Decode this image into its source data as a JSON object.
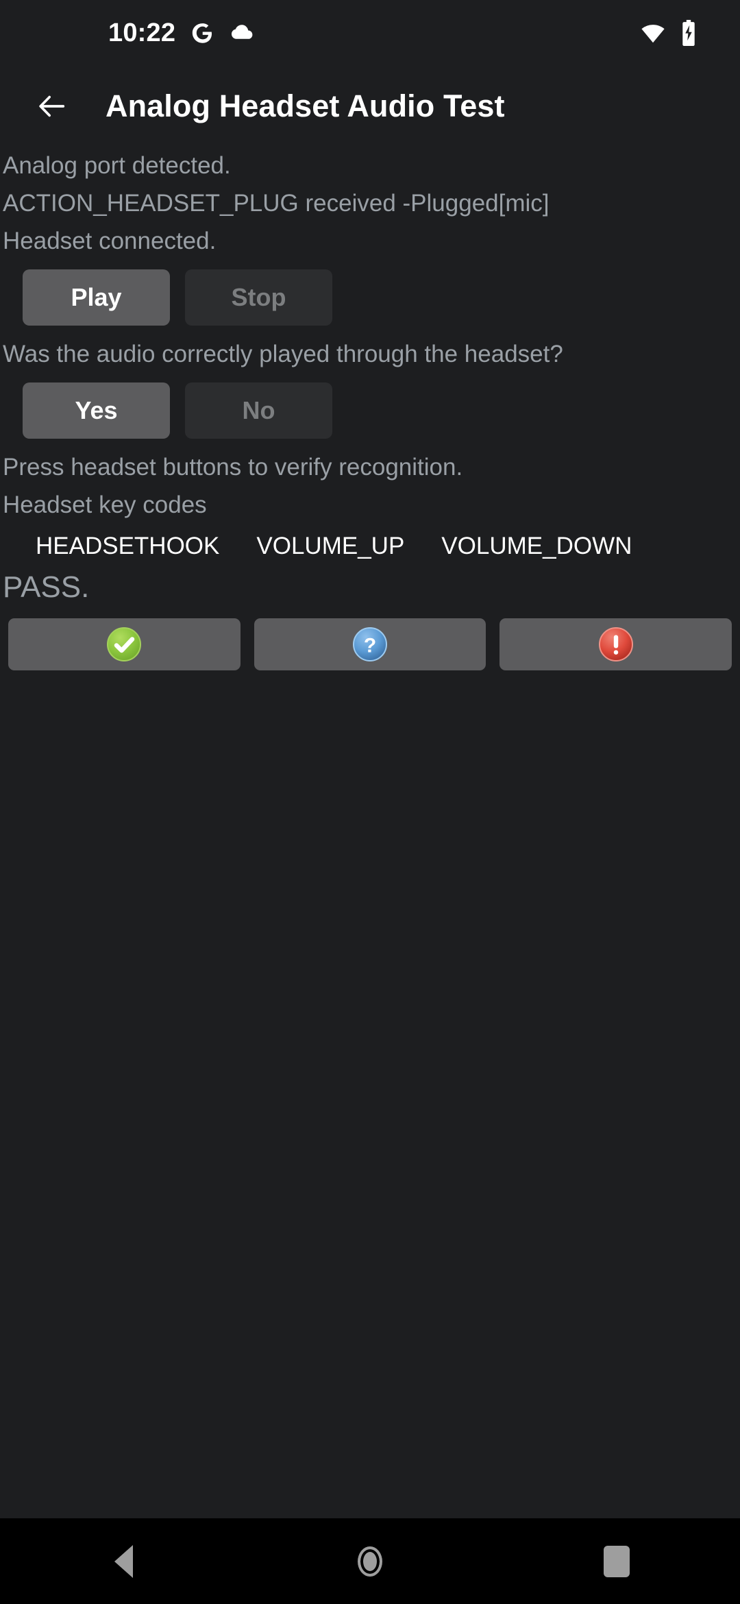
{
  "status_bar": {
    "clock": "10:22",
    "left_icons": [
      "google-g-icon",
      "cloud-icon"
    ],
    "right_icons": [
      "wifi-icon",
      "battery-charging-icon"
    ]
  },
  "app_bar": {
    "back_icon": "back-arrow-icon",
    "title": "Analog Headset Audio Test"
  },
  "content": {
    "status_lines": [
      "Analog port detected.",
      "ACTION_HEADSET_PLUG received -Plugged[mic]",
      "Headset connected."
    ],
    "playback_buttons": [
      {
        "label": "Play",
        "enabled": true
      },
      {
        "label": "Stop",
        "enabled": false
      }
    ],
    "question": "Was the audio correctly played through the headset?",
    "answer_buttons": [
      {
        "label": "Yes",
        "enabled": true
      },
      {
        "label": "No",
        "enabled": false
      }
    ],
    "instruction": "Press headset buttons to verify recognition.",
    "keycodes_label": "Headset key codes",
    "keycodes": [
      "HEADSETHOOK",
      "VOLUME_UP",
      "VOLUME_DOWN"
    ],
    "verdict": "PASS."
  },
  "action_buttons": [
    {
      "name": "pass-button",
      "icon": "check-circle-icon",
      "color": "#8cc63e"
    },
    {
      "name": "info-button",
      "icon": "question-circle-icon",
      "color": "#5b9bd5"
    },
    {
      "name": "fail-button",
      "icon": "exclamation-circle-icon",
      "color": "#e04a3c"
    }
  ],
  "nav_bar": {
    "back": "nav-back-icon",
    "home": "nav-home-icon",
    "recents": "nav-recents-icon"
  },
  "colors": {
    "background": "#1d1e20",
    "nav_background": "#000000",
    "button_enabled": "#5c5c5e",
    "button_disabled": "#2c2d2f",
    "secondary_text": "#9aa0a6",
    "primary_text": "#ffffff"
  }
}
